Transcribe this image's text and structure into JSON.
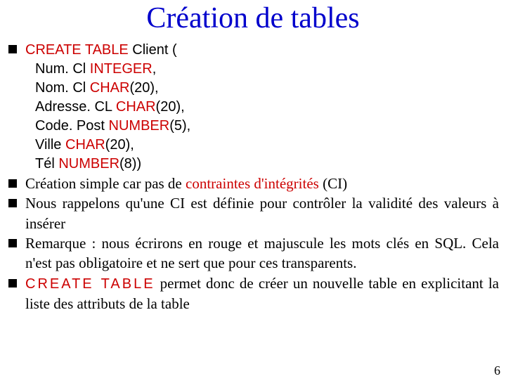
{
  "title": "Création de tables",
  "sql": {
    "createKw": "CREATE TABLE",
    "tableName": " Client (",
    "lines": {
      "l1a": "Num. Cl ",
      "l1b": "INTEGER",
      "l1c": ",",
      "l2a": "Nom. Cl ",
      "l2b": "CHAR",
      "l2c": "(20),",
      "l3a": "Adresse. CL ",
      "l3b": "CHAR",
      "l3c": "(20),",
      "l4a": "Code. Post ",
      "l4b": "NUMBER",
      "l4c": "(5),",
      "l5a": "Ville ",
      "l5b": "CHAR",
      "l5c": "(20),",
      "l6a": "Tél ",
      "l6b": "NUMBER",
      "l6c": "(8))"
    }
  },
  "items": {
    "b2a": " Création simple car pas de ",
    "b2b": "contraintes d'intégrités",
    "b2c": " (CI)",
    "b3": " Nous rappelons qu'une CI est définie pour contrôler la validité des valeurs à insérer",
    "b4": " Remarque : nous écrirons en rouge et majuscule les mots clés en SQL. Cela n'est pas obligatoire et ne sert que pour ces transparents.",
    "b5a": "CREATE TABLE",
    "b5b": " permet donc de créer un nouvelle table en explicitant la liste des attributs de la table"
  },
  "pageNumber": "6"
}
